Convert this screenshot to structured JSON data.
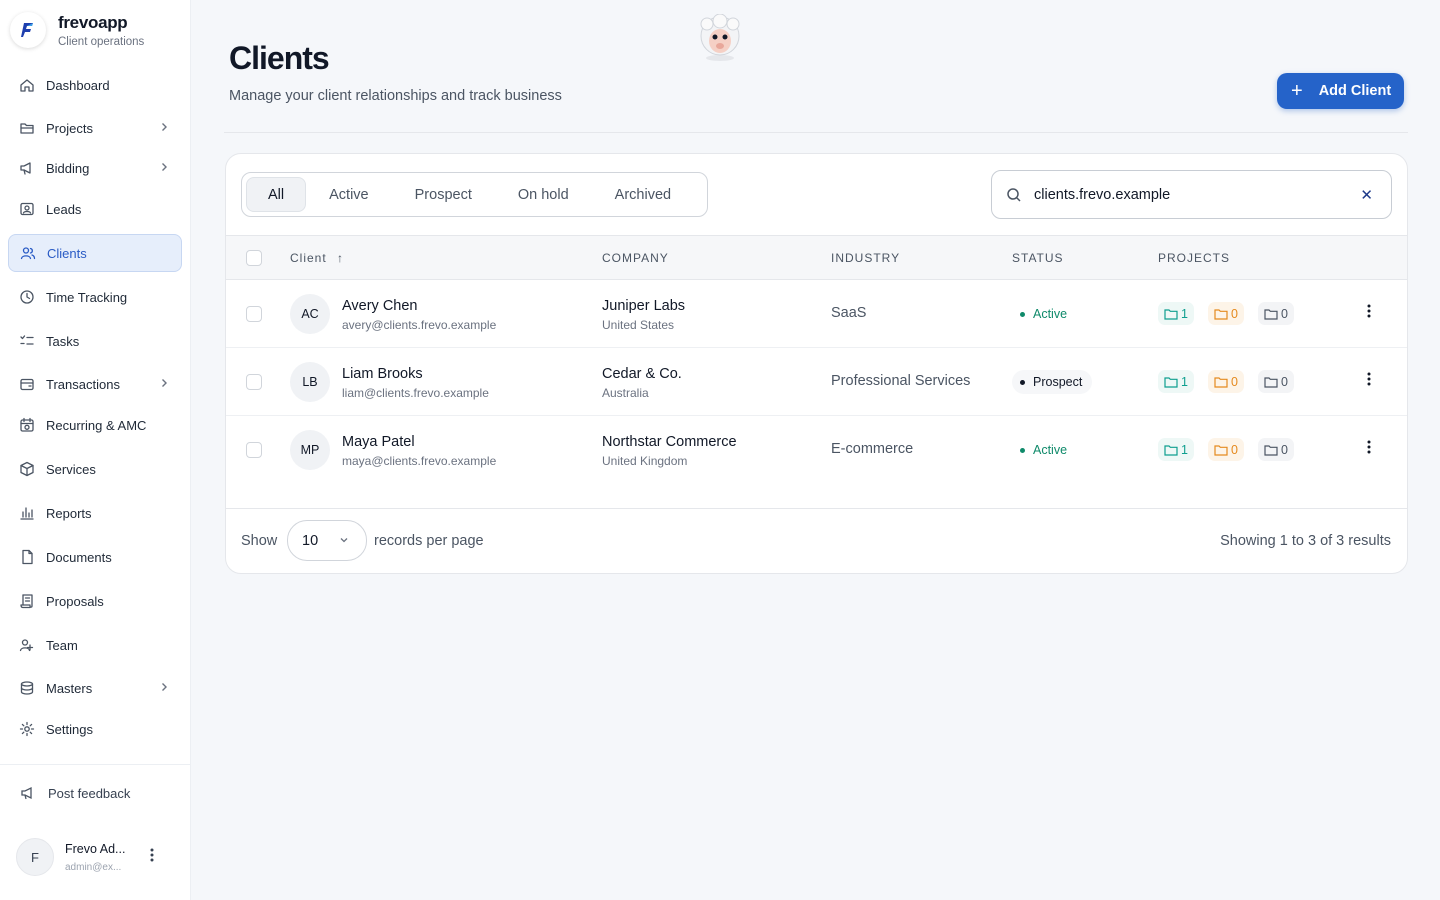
{
  "brand": {
    "name": "frevoapp",
    "subtitle": "Client operations"
  },
  "sidebar": {
    "items": [
      {
        "label": "Dashboard",
        "icon": "home-icon",
        "has_children": false,
        "active": false
      },
      {
        "label": "Projects",
        "icon": "folder-open-icon",
        "has_children": true,
        "active": false
      },
      {
        "label": "Bidding",
        "icon": "megaphone-icon",
        "has_children": true,
        "active": false
      },
      {
        "label": "Leads",
        "icon": "contact-card-icon",
        "has_children": false,
        "active": false
      },
      {
        "label": "Clients",
        "icon": "users-icon",
        "has_children": false,
        "active": true
      },
      {
        "label": "Time Tracking",
        "icon": "clock-icon",
        "has_children": false,
        "active": false
      },
      {
        "label": "Tasks",
        "icon": "checklist-icon",
        "has_children": false,
        "active": false
      },
      {
        "label": "Transactions",
        "icon": "wallet-icon",
        "has_children": true,
        "active": false
      },
      {
        "label": "Recurring & AMC",
        "icon": "calendar-repeat-icon",
        "has_children": false,
        "active": false
      },
      {
        "label": "Services",
        "icon": "box-icon",
        "has_children": false,
        "active": false
      },
      {
        "label": "Reports",
        "icon": "bar-chart-icon",
        "has_children": false,
        "active": false
      },
      {
        "label": "Documents",
        "icon": "document-icon",
        "has_children": false,
        "active": false
      },
      {
        "label": "Proposals",
        "icon": "scroll-icon",
        "has_children": false,
        "active": false
      },
      {
        "label": "Team",
        "icon": "team-icon",
        "has_children": false,
        "active": false
      },
      {
        "label": "Masters",
        "icon": "database-icon",
        "has_children": true,
        "active": false
      },
      {
        "label": "Settings",
        "icon": "gear-icon",
        "has_children": false,
        "active": false
      }
    ],
    "feedback_label": "Post feedback",
    "user": {
      "initial": "F",
      "name": "Frevo Ad...",
      "email": "admin@ex..."
    }
  },
  "header": {
    "title": "Clients",
    "subtitle": "Manage your client relationships and track business",
    "add_button": "Add Client"
  },
  "filters": {
    "tabs": [
      {
        "label": "All",
        "active": true
      },
      {
        "label": "Active",
        "active": false
      },
      {
        "label": "Prospect",
        "active": false
      },
      {
        "label": "On hold",
        "active": false
      },
      {
        "label": "Archived",
        "active": false
      }
    ],
    "search_value": "clients.frevo.example"
  },
  "table": {
    "columns": {
      "client": "Client",
      "company": "COMPANY",
      "industry": "INDUSTRY",
      "status": "STATUS",
      "projects": "PROJECTS"
    },
    "rows": [
      {
        "initials": "AC",
        "name": "Avery Chen",
        "email": "avery@clients.frevo.example",
        "company": "Juniper Labs",
        "country": "United States",
        "industry": "SaaS",
        "status": "Active",
        "projects": {
          "active": "1",
          "hold": "0",
          "done": "0"
        }
      },
      {
        "initials": "LB",
        "name": "Liam Brooks",
        "email": "liam@clients.frevo.example",
        "company": "Cedar & Co.",
        "country": "Australia",
        "industry": "Professional Services",
        "status": "Prospect",
        "projects": {
          "active": "1",
          "hold": "0",
          "done": "0"
        }
      },
      {
        "initials": "MP",
        "name": "Maya Patel",
        "email": "maya@clients.frevo.example",
        "company": "Northstar Commerce",
        "country": "United Kingdom",
        "industry": "E-commerce",
        "status": "Active",
        "projects": {
          "active": "1",
          "hold": "0",
          "done": "0"
        }
      }
    ]
  },
  "pagination": {
    "show_label": "Show",
    "per_page": "10",
    "per_page_label": "records per page",
    "summary": "Showing 1 to 3 of 3 results"
  },
  "colors": {
    "accent": "#2563c9",
    "active_status": "#0f8a6a",
    "prospect_status": "#111827",
    "project_active": "#0e9f8f",
    "project_hold": "#e58a1f",
    "project_done": "#4b5563"
  }
}
